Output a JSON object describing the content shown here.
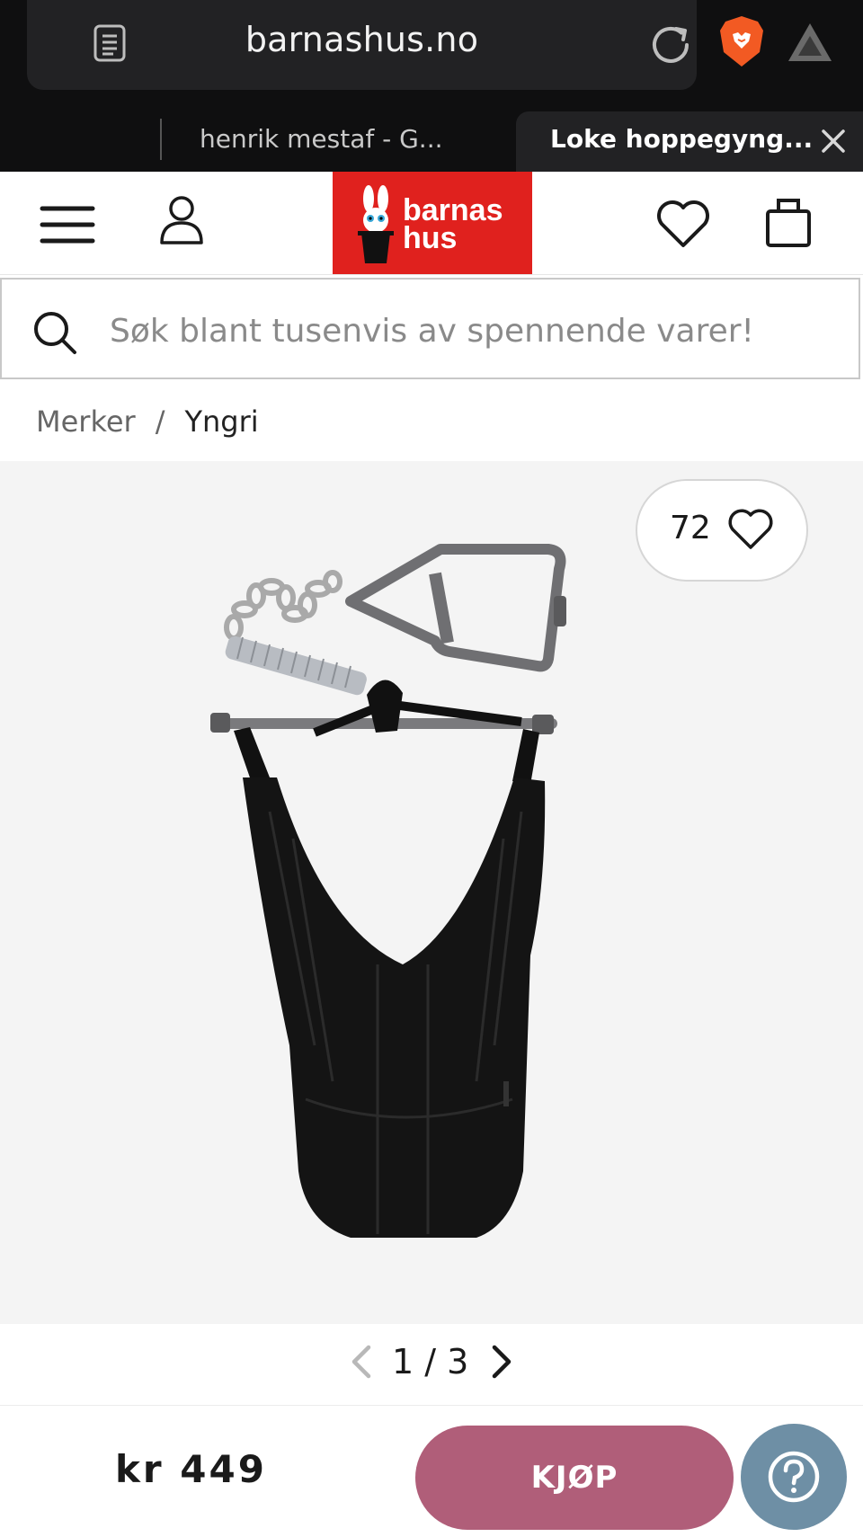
{
  "browser": {
    "url": "barnashus.no",
    "tabs": [
      {
        "label": "henrik mestaf - G..."
      },
      {
        "label": "Loke hoppegyng..."
      }
    ]
  },
  "header": {
    "logo_line1": "barnas",
    "logo_line2": "hus"
  },
  "search": {
    "placeholder": "Søk blant tusenvis av spennende varer!"
  },
  "breadcrumb": {
    "items": [
      "Merker",
      "Yngri"
    ],
    "separator": "/"
  },
  "product": {
    "likes": "72",
    "pager": "1 / 3",
    "price": "kr 449",
    "buy_label": "KJØP"
  },
  "colors": {
    "brand_red": "#e0211e",
    "buy_button": "#b05e79",
    "help_button": "#6e8fa5"
  }
}
